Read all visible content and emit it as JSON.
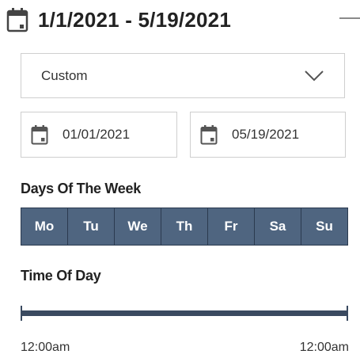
{
  "header": {
    "title": "1/1/2021 - 5/19/2021",
    "icon": "calendar-icon",
    "collapse_icon": "minus-icon"
  },
  "preset": {
    "selected": "Custom",
    "icon": "chevron-down-icon"
  },
  "dates": {
    "start": "01/01/2021",
    "end": "05/19/2021"
  },
  "days_of_week": {
    "label": "Days Of The Week",
    "days": [
      "Mo",
      "Tu",
      "We",
      "Th",
      "Fr",
      "Sa",
      "Su"
    ],
    "selected": [
      true,
      true,
      true,
      true,
      true,
      true,
      true
    ]
  },
  "time_of_day": {
    "label": "Time Of Day",
    "start": "12:00am",
    "end": "12:00am",
    "range_fraction": [
      0,
      1
    ]
  },
  "colors": {
    "day_selected_bg": "#4f6580",
    "day_border": "#2b3a4f",
    "slider_track": "#3a4a60",
    "border": "#cfcfcf"
  }
}
